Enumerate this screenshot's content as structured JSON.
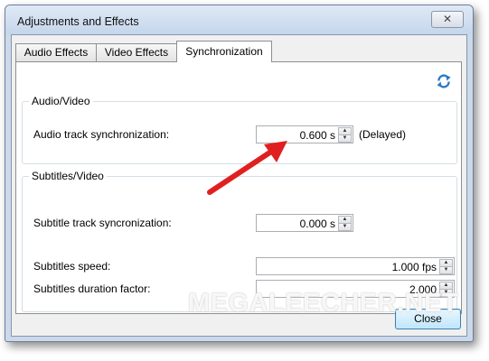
{
  "window": {
    "title": "Adjustments and Effects",
    "close_glyph": "✕"
  },
  "tabs": [
    {
      "label": "Audio Effects",
      "active": false
    },
    {
      "label": "Video Effects",
      "active": false
    },
    {
      "label": "Synchronization",
      "active": true
    }
  ],
  "audio_video": {
    "group_label": "Audio/Video",
    "audio_sync": {
      "label": "Audio track synchronization:",
      "value": "0.600 s",
      "status": "(Delayed)"
    }
  },
  "subtitles_video": {
    "group_label": "Subtitles/Video",
    "subtitle_sync": {
      "label": "Subtitle track syncronization:",
      "value": "0.000 s"
    },
    "speed": {
      "label": "Subtitles speed:",
      "value": "1.000 fps"
    },
    "duration_factor": {
      "label": "Subtitles duration factor:",
      "value": "2.000"
    }
  },
  "buttons": {
    "close_label": "Close"
  },
  "icons": {
    "reset": "refresh-icon",
    "spin_up": "up-arrow-icon",
    "spin_down": "down-arrow-icon",
    "annotation": "red-arrow"
  },
  "colors": {
    "accent": "#3c7fb1",
    "arrow": "#e02020",
    "window_frame": "#cbd9ea"
  },
  "watermark": "MEGALEECHER.NET"
}
